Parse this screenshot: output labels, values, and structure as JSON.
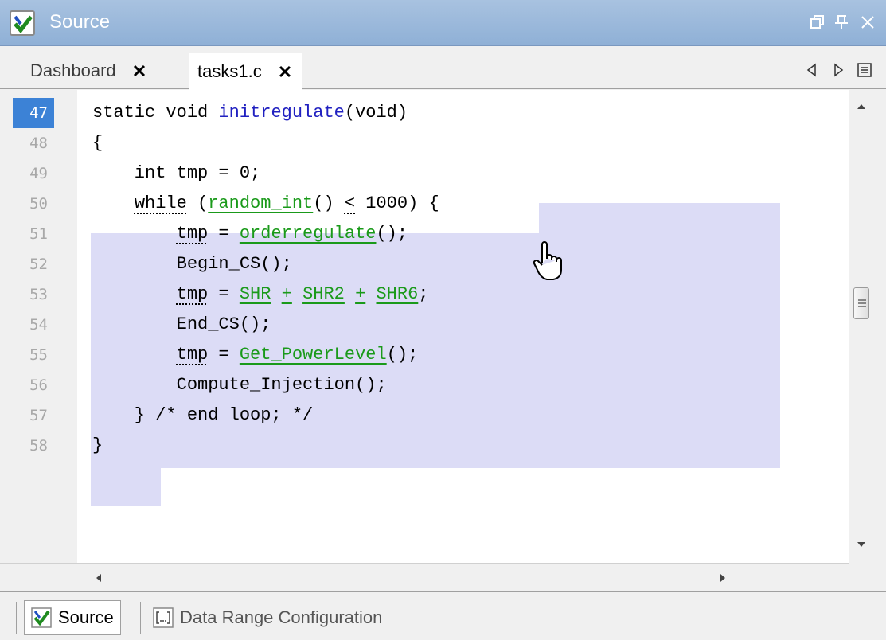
{
  "window": {
    "title": "Source"
  },
  "tabs": [
    {
      "label": "Dashboard"
    },
    {
      "label": "tasks1.c"
    }
  ],
  "editor": {
    "current_line": "47",
    "line_numbers": [
      "47",
      "48",
      "49",
      "50",
      "51",
      "52",
      "53",
      "54",
      "55",
      "56",
      "57",
      "58"
    ]
  },
  "bottom_tabs": [
    {
      "label": "Source"
    },
    {
      "label": "Data Range Configuration"
    }
  ],
  "icons": {
    "app": "check-icon",
    "restore": "restore-icon",
    "pin": "pin-icon",
    "close": "close-icon",
    "prev": "triangle-left-icon",
    "next": "triangle-right-icon",
    "list": "list-icon",
    "hand": "hand-cursor-icon",
    "data_range": "bracket-icon"
  },
  "colors": {
    "current_line": "#3c82d6",
    "highlight": "#dcdcf6",
    "link": "#1a9a1a",
    "function_def": "#2020c0",
    "title_bar": "#9db9dc"
  }
}
